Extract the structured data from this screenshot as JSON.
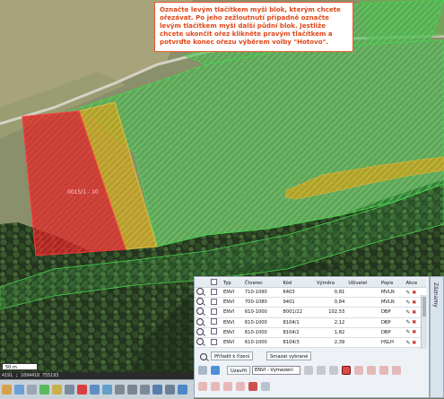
{
  "tooltip": {
    "text": "Označte levým tlačítkem myši blok, kterým chcete ořezávat. Po jeho zežloutnutí případně označte levým tlačítkem myši další půdní blok. Jestliže chcete ukončit ořez klikněte pravým tlačítkem a potvrďte konec ořezu výběrem volby \"Hotovo\"."
  },
  "map": {
    "block_label": "0015/1 - 10",
    "scale_label": "50 m",
    "coords_text": "4191 ; 1094410 755193"
  },
  "panel": {
    "side_tab_label": "Záznamy",
    "columns": [
      "",
      "",
      "Typ",
      "Čtverec",
      "Kód",
      "Výměra",
      "Uživatel",
      "Popis",
      "Akce"
    ],
    "rows": [
      {
        "typ": "ENVI",
        "ctverec": "710-1090",
        "kod": "6403",
        "vymera": "0,81",
        "uzivatel": "",
        "popis": "MVLN"
      },
      {
        "typ": "ENVI",
        "ctverec": "700-1080",
        "kod": "9401",
        "vymera": "0,84",
        "uzivatel": "",
        "popis": "MVLN"
      },
      {
        "typ": "ENVI",
        "ctverec": "610-1000",
        "kod": "8001/22",
        "vymera": "102,53",
        "uzivatel": "",
        "popis": "DBP"
      },
      {
        "typ": "ENVI",
        "ctverec": "610-1000",
        "kod": "8104/1",
        "vymera": "2,12",
        "uzivatel": "",
        "popis": "DBP"
      },
      {
        "typ": "ENVI",
        "ctverec": "610-1000",
        "kod": "8104/2",
        "vymera": "1,82",
        "uzivatel": "",
        "popis": "DBP"
      },
      {
        "typ": "ENVI",
        "ctverec": "610-1000",
        "kod": "8104/3",
        "vymera": "2,39",
        "uzivatel": "",
        "popis": "HSLH"
      }
    ],
    "btn_assign": "Přiřadit k řízení",
    "btn_delete_selected": "Smazat vybrané",
    "btn_close": "Uzavřít",
    "select_value": "ENVI - Vymezení"
  },
  "colors": {
    "tooltip_text": "#e0461a",
    "green_hatch": "#3fb84a",
    "red_block": "#e02020",
    "yellow_block": "#c7a11a"
  }
}
